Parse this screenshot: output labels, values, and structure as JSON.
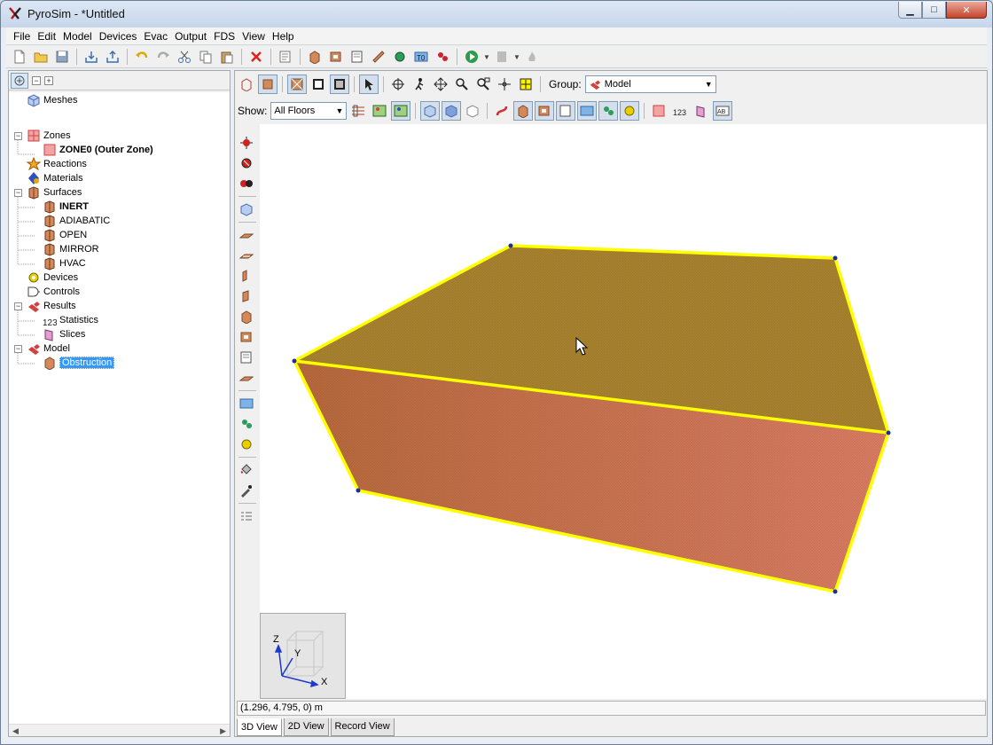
{
  "window": {
    "title": "PyroSim - *Untitled",
    "minimize": "▁",
    "maximize": "□",
    "close": "✕"
  },
  "menu": [
    "File",
    "Edit",
    "Model",
    "Devices",
    "Evac",
    "Output",
    "FDS",
    "View",
    "Help"
  ],
  "tree": {
    "items": [
      {
        "label": "Meshes"
      },
      {
        "label": "Zones"
      },
      {
        "label": "ZONE0 (Outer Zone)"
      },
      {
        "label": "Reactions"
      },
      {
        "label": "Materials"
      },
      {
        "label": "Surfaces"
      },
      {
        "label": "INERT"
      },
      {
        "label": "ADIABATIC"
      },
      {
        "label": "OPEN"
      },
      {
        "label": "MIRROR"
      },
      {
        "label": "HVAC"
      },
      {
        "label": "Devices"
      },
      {
        "label": "Controls"
      },
      {
        "label": "Results"
      },
      {
        "label": "Statistics"
      },
      {
        "label": "Slices"
      },
      {
        "label": "Model"
      },
      {
        "label": "Obstruction"
      }
    ]
  },
  "editor": {
    "group_label": "Group:",
    "group_value": "Model",
    "show_label": "Show:",
    "show_value": "All Floors",
    "status_coords": "(1.296, 4.795, 0) m",
    "axes": {
      "x": "X",
      "y": "Y",
      "z": "Z"
    },
    "tabs": [
      "3D View",
      "2D View",
      "Record View"
    ]
  },
  "colors": {
    "selection_outline": "#ffff00",
    "obstruction_top": "#a8822e",
    "obstruction_front": "#d67a55",
    "tree_selected": "#3399ff"
  }
}
